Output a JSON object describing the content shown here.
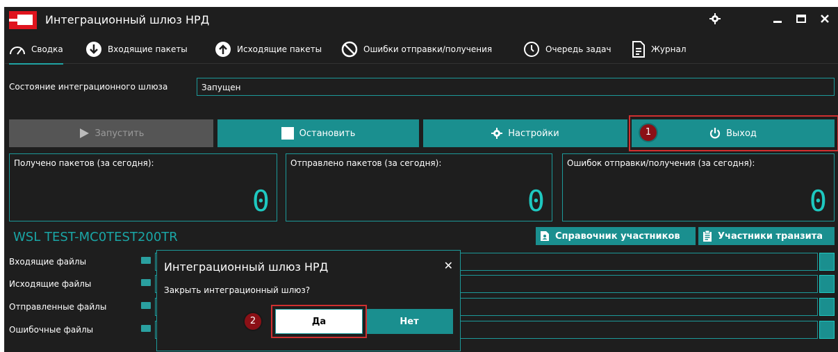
{
  "window": {
    "title": "Интеграционный шлюз НРД"
  },
  "menu": {
    "items": [
      {
        "label": "Сводка"
      },
      {
        "label": "Входящие пакеты"
      },
      {
        "label": "Исходящие пакеты"
      },
      {
        "label": "Ошибки отправки/получения"
      },
      {
        "label": "Очередь задач"
      },
      {
        "label": "Журнал"
      }
    ]
  },
  "status": {
    "label": "Состояние интеграционного шлюза",
    "value": "Запущен"
  },
  "actions": {
    "start": "Запустить",
    "stop": "Остановить",
    "settings": "Настройки",
    "exit": "Выход"
  },
  "stats": [
    {
      "label": "Получено пакетов (за сегодня):",
      "value": "0"
    },
    {
      "label": "Отправлено пакетов (за сегодня):",
      "value": "0"
    },
    {
      "label": "Ошибок отправки/получения (за сегодня):",
      "value": "0"
    }
  ],
  "wsl": {
    "name": "WSL TEST-MC0TEST200TR",
    "directory_button": "Справочник участников",
    "transit_button": "Участники транзита"
  },
  "folders": [
    {
      "label": "Входящие файлы"
    },
    {
      "label": "Исходящие файлы"
    },
    {
      "label": "Отправленные файлы"
    },
    {
      "label": "Ошибочные файлы"
    }
  ],
  "dialog": {
    "title": "Интеграционный шлюз НРД",
    "message": "Закрыть интеграционный шлюз?",
    "yes": "Да",
    "no": "Нет"
  },
  "annotations": {
    "step1": "1",
    "step2": "2"
  },
  "colors": {
    "accent": "#1a8f8f",
    "highlight": "#d03030",
    "badge": "#8b1016",
    "background": "#1e1e1e",
    "counter": "#1ec8c0"
  }
}
